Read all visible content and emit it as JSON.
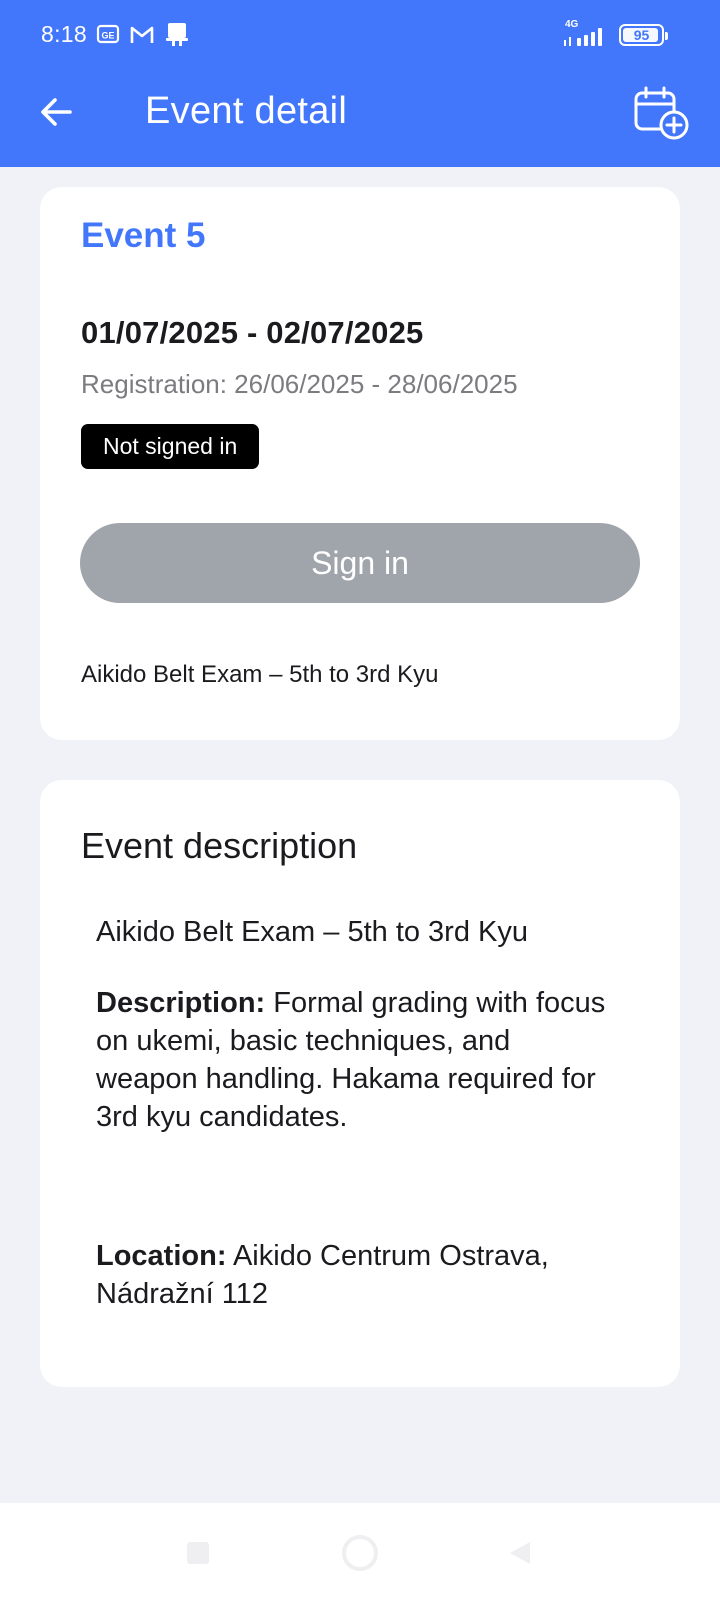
{
  "status_bar": {
    "time": "8:18",
    "network": "4G",
    "battery": "95",
    "battery_level": 0.95,
    "icons": [
      "sim-icon",
      "gmail-icon",
      "notification-icon",
      "signal-icon",
      "battery-icon"
    ]
  },
  "app_bar": {
    "title": "Event detail",
    "back_icon": "arrow-back-icon",
    "calendar_icon": "calendar-add-icon"
  },
  "event": {
    "name": "Event 5",
    "dates": "01/07/2025 - 02/07/2025",
    "registration": "Registration: 26/06/2025 - 28/06/2025",
    "status_badge": "Not signed in",
    "sign_in_label": "Sign in",
    "short_description": "Aikido Belt Exam – 5th to 3rd Kyu"
  },
  "description": {
    "heading": "Event description",
    "title": "Aikido Belt Exam – 5th to 3rd Kyu",
    "description_label": "Description:",
    "description_text": "Formal grading with focus on ukemi, basic techniques, and weapon handling. Hakama required for 3rd kyu candidates.",
    "location_label": "Location:",
    "location_text": "Aikido Centrum Ostrava, Nádražní 112"
  },
  "colors": {
    "primary": "#4377fb",
    "background": "#f0f2f7",
    "disabled_button": "#a0a4ab",
    "badge": "#000000"
  },
  "nav_bar": {
    "buttons": [
      "recent-apps-icon",
      "home-icon",
      "back-icon"
    ]
  }
}
